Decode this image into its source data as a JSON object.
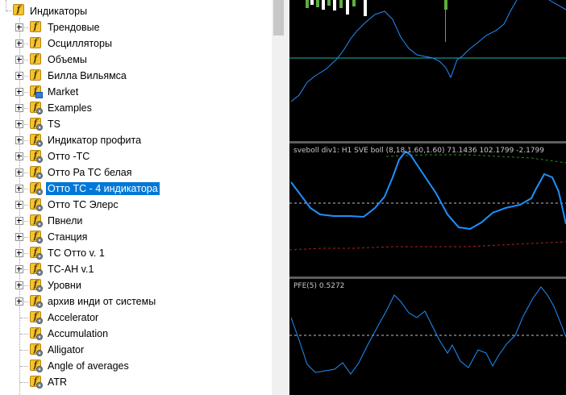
{
  "navigator": {
    "root": {
      "label": "Индикаторы",
      "expanded": true
    },
    "items": [
      {
        "label": "Трендовые",
        "type": "folder",
        "icon": "folder-indicator-icon",
        "expandable": true
      },
      {
        "label": "Осцилляторы",
        "type": "folder",
        "icon": "folder-indicator-icon",
        "expandable": true
      },
      {
        "label": "Объемы",
        "type": "folder",
        "icon": "folder-indicator-icon",
        "expandable": true
      },
      {
        "label": "Билла Вильямса",
        "type": "folder",
        "icon": "folder-indicator-icon",
        "expandable": true
      },
      {
        "label": "Market",
        "type": "folder",
        "icon": "market-folder-icon",
        "expandable": true
      },
      {
        "label": "Examples",
        "type": "folder",
        "icon": "custom-folder-icon",
        "expandable": true
      },
      {
        "label": "TS",
        "type": "folder",
        "icon": "custom-folder-icon",
        "expandable": true
      },
      {
        "label": "Индикатор профита",
        "type": "folder",
        "icon": "custom-folder-icon",
        "expandable": true
      },
      {
        "label": "Отто -ТС",
        "type": "folder",
        "icon": "custom-folder-icon",
        "expandable": true
      },
      {
        "label": "Отто Ра ТС белая",
        "type": "folder",
        "icon": "custom-folder-icon",
        "expandable": true
      },
      {
        "label": "Отто ТС - 4 индикатора",
        "type": "folder",
        "icon": "custom-folder-icon",
        "expandable": true,
        "selected": true
      },
      {
        "label": "Отто ТС Элерс",
        "type": "folder",
        "icon": "custom-folder-icon",
        "expandable": true
      },
      {
        "label": "Пвнели",
        "type": "folder",
        "icon": "custom-folder-icon",
        "expandable": true
      },
      {
        "label": "Станция",
        "type": "folder",
        "icon": "custom-folder-icon",
        "expandable": true
      },
      {
        "label": "ТС Отто v. 1",
        "type": "folder",
        "icon": "custom-folder-icon",
        "expandable": true
      },
      {
        "label": "ТС-АН v.1",
        "type": "folder",
        "icon": "custom-folder-icon",
        "expandable": true
      },
      {
        "label": "Уровни",
        "type": "folder",
        "icon": "custom-folder-icon",
        "expandable": true
      },
      {
        "label": "архив инди от системы",
        "type": "folder",
        "icon": "custom-folder-icon",
        "expandable": true
      },
      {
        "label": "Accelerator",
        "type": "indicator",
        "icon": "custom-indicator-icon",
        "expandable": false
      },
      {
        "label": "Accumulation",
        "type": "indicator",
        "icon": "custom-indicator-icon",
        "expandable": false
      },
      {
        "label": "Alligator",
        "type": "indicator",
        "icon": "custom-indicator-icon",
        "expandable": false
      },
      {
        "label": "Angle of averages",
        "type": "indicator",
        "icon": "custom-indicator-icon",
        "expandable": false
      },
      {
        "label": "ATR",
        "type": "indicator",
        "icon": "custom-indicator-icon",
        "expandable": false
      }
    ]
  },
  "chart": {
    "subwindow1": {
      "label": "sveboll div1: H1 SVE boll (8,18,1.60,1.60) 71.1436 102.1799 -2.1799"
    },
    "subwindow2": {
      "label": "PFE(5) 0.5272"
    }
  },
  "colors": {
    "selection": "#0078d7",
    "folder_icon": "#f4c430",
    "chart_background": "#000000",
    "oscillator_line": "#1e90ff",
    "upper_band": "#2e8b22",
    "lower_band": "#b22222",
    "level_line": "#20b2aa",
    "level_dashed": "#c0c0c0"
  }
}
